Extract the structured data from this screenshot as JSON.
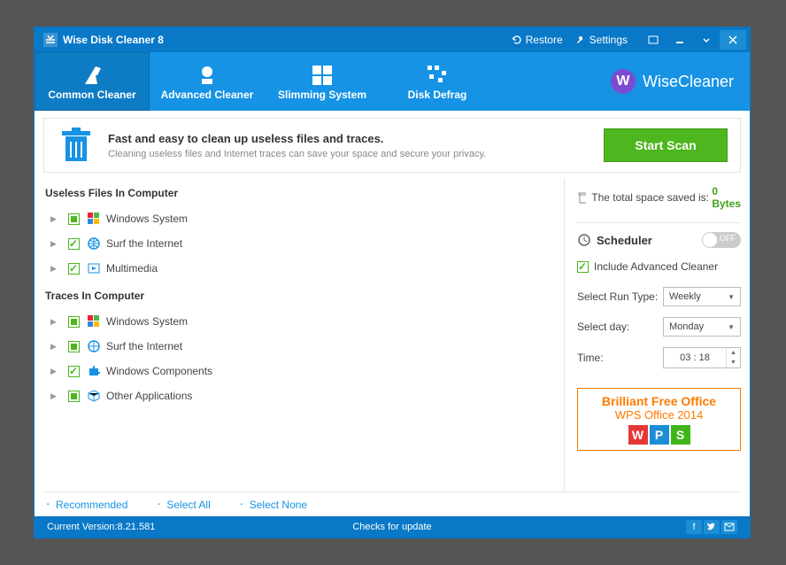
{
  "titlebar": {
    "title": "Wise Disk Cleaner 8",
    "restore": "Restore",
    "settings": "Settings"
  },
  "tabs": [
    {
      "label": "Common Cleaner",
      "active": true
    },
    {
      "label": "Advanced Cleaner",
      "active": false
    },
    {
      "label": "Slimming System",
      "active": false
    },
    {
      "label": "Disk Defrag",
      "active": false
    }
  ],
  "brand": "WiseCleaner",
  "banner": {
    "headline": "Fast and easy to clean up useless files and traces.",
    "sub": "Cleaning useless files and Internet traces can save your space and secure your privacy.",
    "button": "Start Scan"
  },
  "left": {
    "section1": "Useless Files In Computer",
    "section2": "Traces In Computer",
    "items1": [
      {
        "label": "Windows System",
        "check": "partial",
        "icon": "windows"
      },
      {
        "label": "Surf the Internet",
        "check": "checked",
        "icon": "globe"
      },
      {
        "label": "Multimedia",
        "check": "checked",
        "icon": "media"
      }
    ],
    "items2": [
      {
        "label": "Windows System",
        "check": "partial",
        "icon": "windows"
      },
      {
        "label": "Surf the Internet",
        "check": "partial",
        "icon": "globe"
      },
      {
        "label": "Windows Components",
        "check": "checked",
        "icon": "puzzle"
      },
      {
        "label": "Other Applications",
        "check": "partial",
        "icon": "cube"
      }
    ]
  },
  "right": {
    "saved_prefix": "The total space saved is: ",
    "saved_value": "0 Bytes",
    "scheduler": "Scheduler",
    "toggle": "OFF",
    "include": "Include Advanced Cleaner",
    "runtype_label": "Select Run Type:",
    "runtype_value": "Weekly",
    "day_label": "Select day:",
    "day_value": "Monday",
    "time_label": "Time:",
    "time_value": "03 : 18",
    "ad_l1": "Brilliant Free Office",
    "ad_l2": "WPS Office 2014"
  },
  "bottom": {
    "recommended": "Recommended",
    "select_all": "Select All",
    "select_none": "Select None"
  },
  "status": {
    "version": "Current Version:8.21.581",
    "update": "Checks for update"
  }
}
